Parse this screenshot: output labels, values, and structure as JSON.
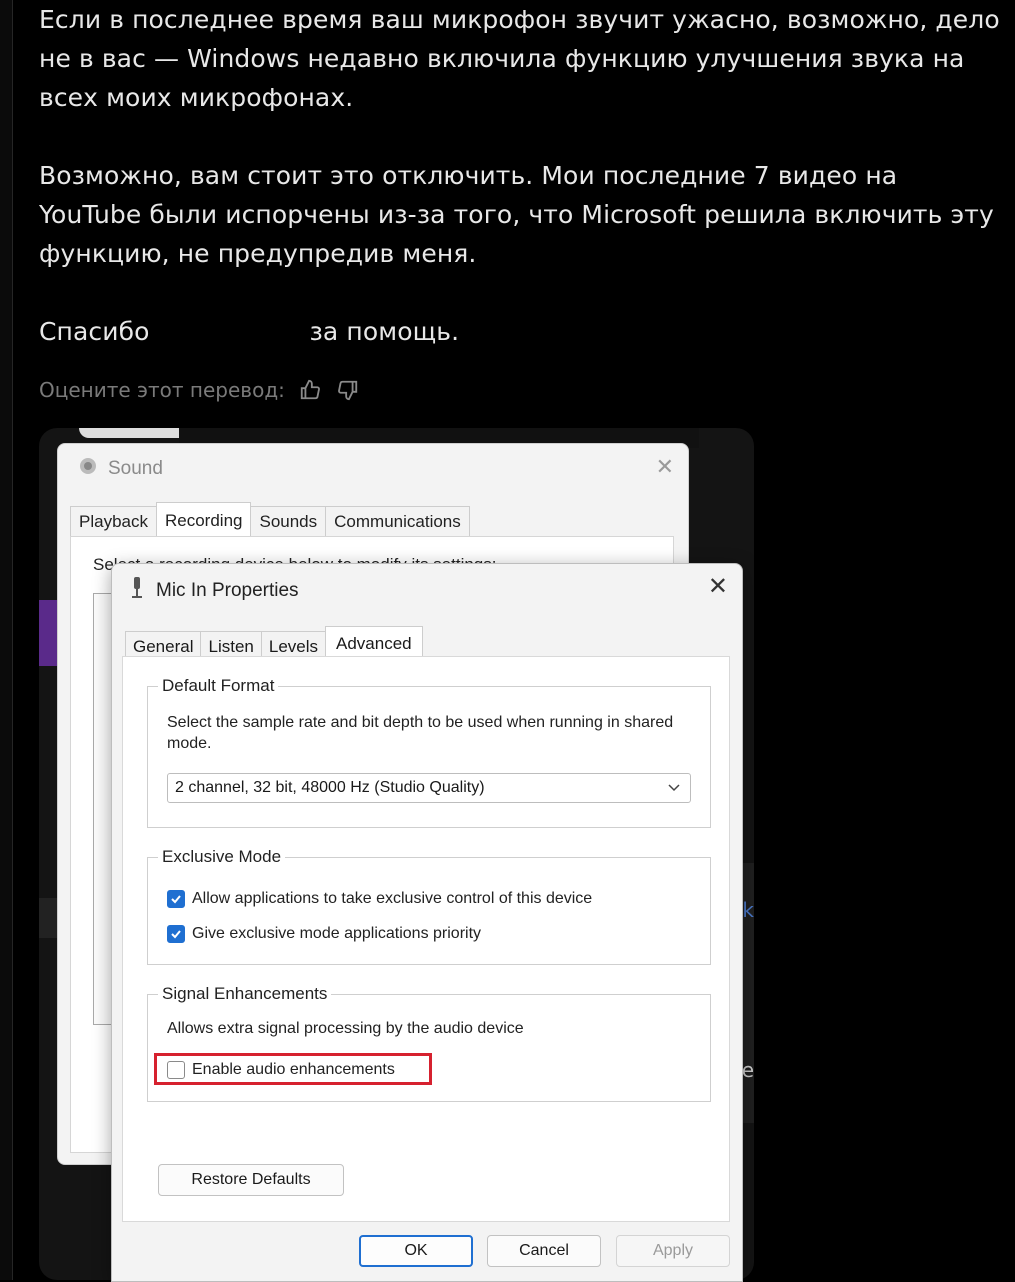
{
  "post": {
    "paragraph1": "Если в последнее время ваш микрофон звучит ужасно, возможно, дело не в вас — Windows недавно включила функцию улучшения звука на всех моих микрофонах.",
    "paragraph2": "Возможно, вам стоит это отключить. Мои последние 7 видео на YouTube были испорчены из-за того, что Microsoft решила включить эту функцию, не предупредив меня.",
    "thanks_before": "Спасибо",
    "thanks_after": "за помощь."
  },
  "rating": {
    "label": "Оцените этот перевод:",
    "thumbs_up_icon": "thumbs-up-icon",
    "thumbs_down_icon": "thumbs-down-icon"
  },
  "sound_window": {
    "title": "Sound",
    "tabs": [
      "Playback",
      "Recording",
      "Sounds",
      "Communications"
    ],
    "active_tab": "Recording",
    "instruction": "Select a recording device below to modify its settings:"
  },
  "mic_window": {
    "title": "Mic In Properties",
    "tabs": [
      "General",
      "Listen",
      "Levels",
      "Advanced"
    ],
    "active_tab": "Advanced",
    "default_format": {
      "label": "Default Format",
      "description": "Select the sample rate and bit depth to be used when running in shared mode.",
      "selected": "2 channel, 32 bit, 48000 Hz (Studio Quality)"
    },
    "exclusive_mode": {
      "label": "Exclusive Mode",
      "options": [
        {
          "label": "Allow applications to take exclusive control of this device",
          "checked": true
        },
        {
          "label": "Give exclusive mode applications priority",
          "checked": true
        }
      ]
    },
    "signal_enhancements": {
      "label": "Signal Enhancements",
      "description": "Allows extra signal processing by the audio device",
      "option": {
        "label": "Enable audio enhancements",
        "checked": false
      }
    },
    "buttons": {
      "restore": "Restore Defaults",
      "ok": "OK",
      "cancel": "Cancel",
      "apply": "Apply"
    }
  },
  "colors": {
    "accent": "#1f6fd1",
    "highlight": "#d6212f",
    "background": "#000000"
  }
}
